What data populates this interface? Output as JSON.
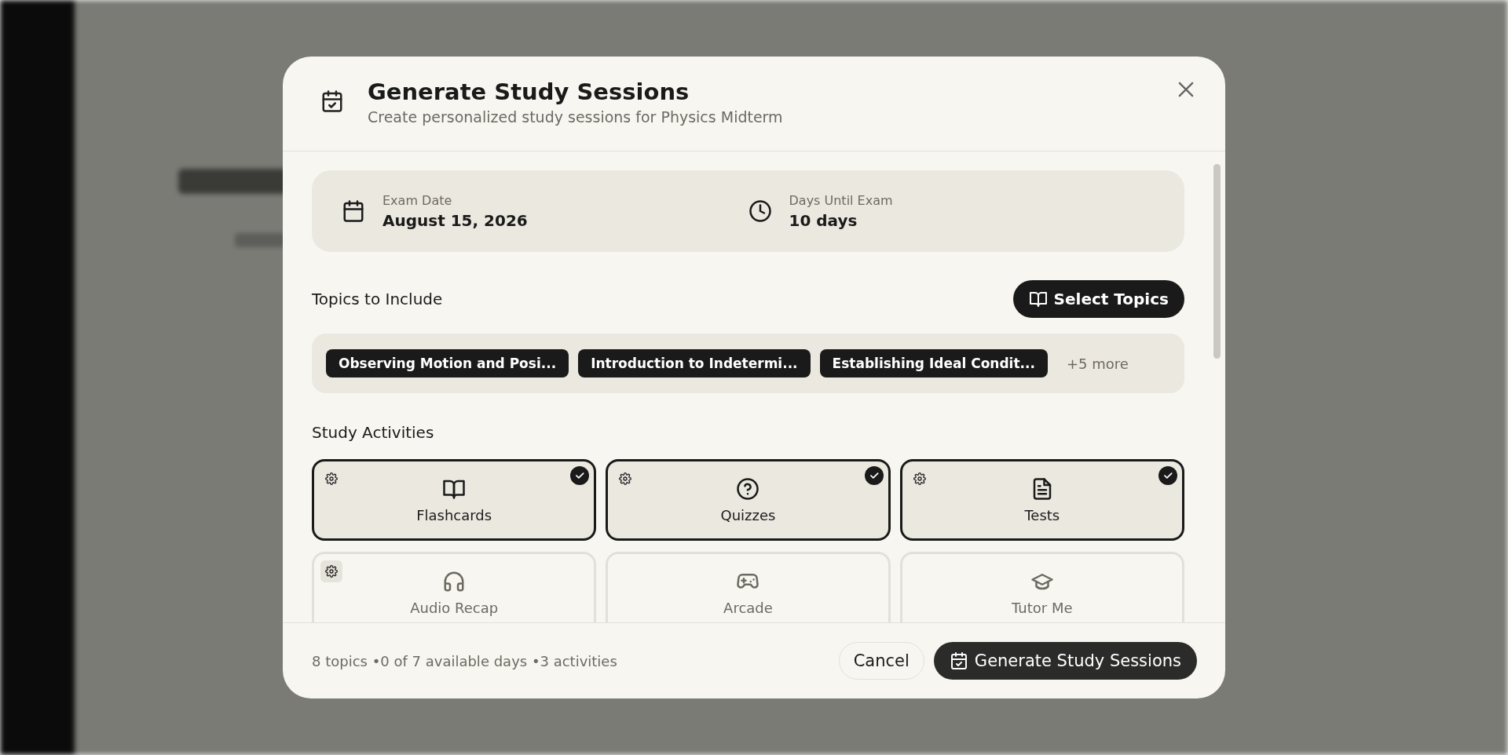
{
  "dialog": {
    "title": "Generate Study Sessions",
    "subtitle": "Create personalized study sessions for Physics Midterm"
  },
  "exam_info": [
    {
      "label": "Exam Date",
      "value": "August 15, 2026"
    },
    {
      "label": "Days Until Exam",
      "value": "10 days"
    }
  ],
  "topics": {
    "heading": "Topics to Include",
    "select_button": "Select Topics",
    "chips": [
      "Observing Motion and Posi...",
      "Introduction to Indetermi...",
      "Establishing Ideal Condit..."
    ],
    "more": "+5 more"
  },
  "activities": {
    "heading": "Study Activities",
    "items": [
      {
        "label": "Flashcards",
        "selected": true,
        "settings": true
      },
      {
        "label": "Quizzes",
        "selected": true,
        "settings": true
      },
      {
        "label": "Tests",
        "selected": true,
        "settings": true
      },
      {
        "label": "Audio Recap",
        "selected": false,
        "settings": true
      },
      {
        "label": "Arcade",
        "selected": false,
        "settings": false
      },
      {
        "label": "Tutor Me",
        "selected": false,
        "settings": false
      }
    ]
  },
  "footer": {
    "summary": "8 topics •0 of 7 available days •3 activities",
    "cancel": "Cancel",
    "generate": "Generate Study Sessions"
  }
}
